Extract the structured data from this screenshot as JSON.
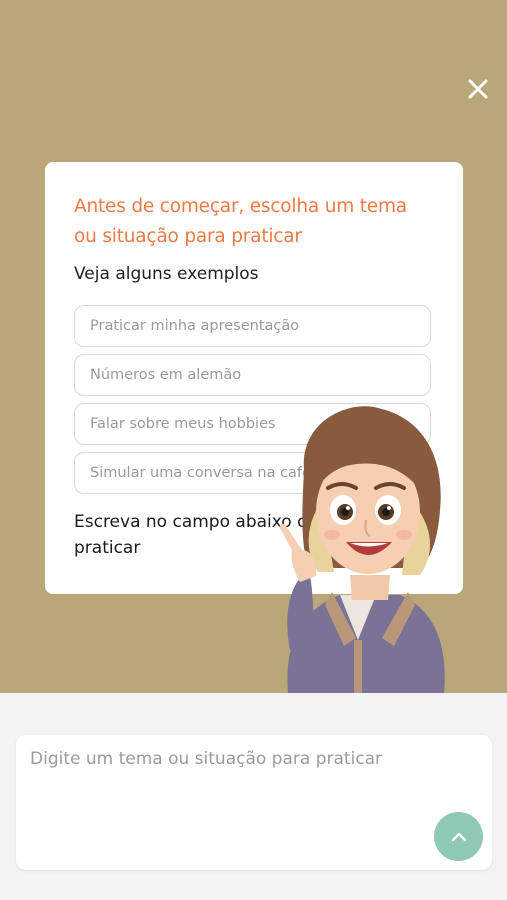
{
  "modal": {
    "title": "Antes de começar, escolha um tema ou situação para praticar",
    "subtitle": "Veja alguns exemplos",
    "examples": [
      {
        "label": "Praticar minha apresentação"
      },
      {
        "label": "Números em alemão"
      },
      {
        "label": "Falar sobre meus hobbies"
      },
      {
        "label": "Simular uma conversa na cafeteria"
      }
    ],
    "instruction": "Escreva no campo abaixo o que deseja praticar"
  },
  "composer": {
    "placeholder": "Digite um tema ou situação para praticar",
    "send_icon": "chevron-up-icon"
  },
  "icons": {
    "close": "close-icon"
  },
  "colors": {
    "overlay_bg": "#b9a679",
    "title": "#f07a45",
    "send_button": "#8fc9b5"
  }
}
